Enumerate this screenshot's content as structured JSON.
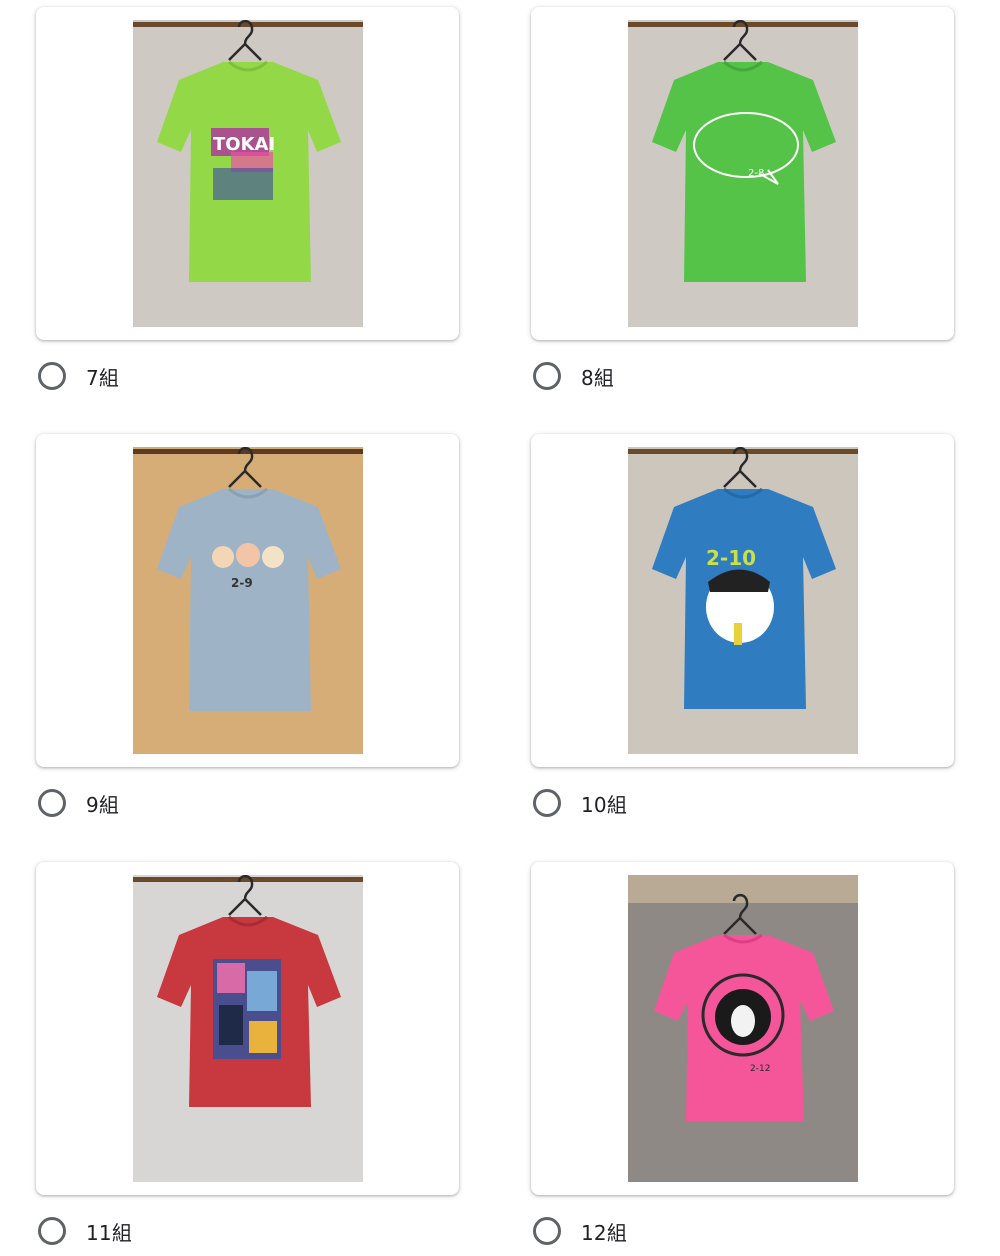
{
  "options": [
    {
      "label": "7組",
      "shirt_color": "#93d947",
      "wall_color": "#cfc9c3",
      "print": "text-splash",
      "print_text": "TOKAI"
    },
    {
      "label": "8組",
      "shirt_color": "#55c348",
      "wall_color": "#cfc9c3",
      "print": "speech-bubble",
      "print_text": "2-8"
    },
    {
      "label": "9組",
      "shirt_color": "#9fb3c7",
      "wall_color": "#d6ad77",
      "print": "animals",
      "print_text": "2-9"
    },
    {
      "label": "10組",
      "shirt_color": "#2f7cc1",
      "wall_color": "#cdc6bd",
      "print": "boy",
      "print_text": "2-10"
    },
    {
      "label": "11組",
      "shirt_color": "#c8383f",
      "wall_color": "#d8d6d4",
      "print": "collage",
      "print_text": ""
    },
    {
      "label": "12組",
      "shirt_color": "#f5569a",
      "wall_color": "#8f8985",
      "print": "face-circle",
      "print_text": "2-12"
    }
  ],
  "colors": {
    "radio_border": "#5f6368",
    "label_text": "#202124",
    "hanger": "#2a2a2a",
    "rail": "#6b4a2b"
  }
}
